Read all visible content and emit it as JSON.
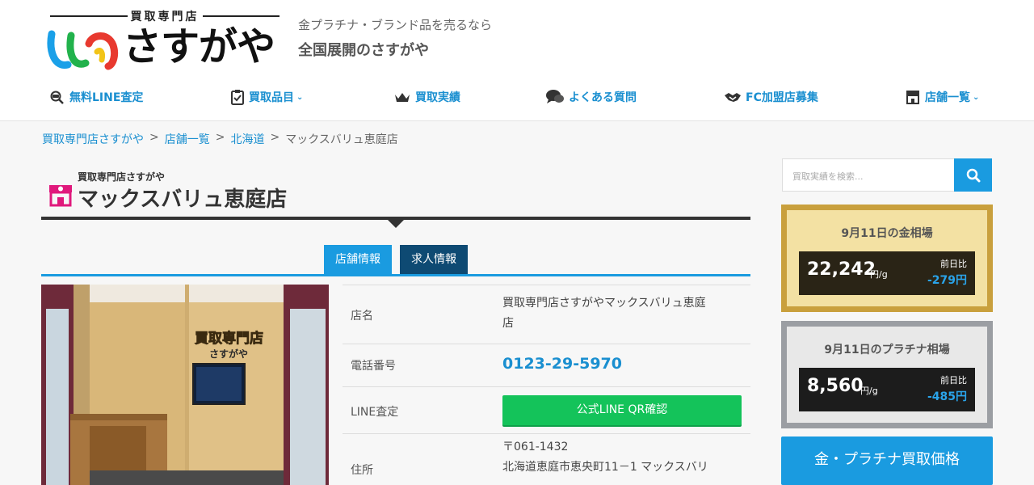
{
  "header": {
    "logo_top": "買取専門店",
    "logo_name": "さすがや",
    "tagline": "金プラチナ・ブランド品を売るなら",
    "tagline2": "全国展開のさすがや"
  },
  "nav": {
    "items": [
      {
        "label": "無料LINE査定",
        "icon": "line-magnifier-icon"
      },
      {
        "label": "買取品目",
        "icon": "clipboard-check-icon",
        "dropdown": true
      },
      {
        "label": "買取実績",
        "icon": "crown-icon"
      },
      {
        "label": "よくある質問",
        "icon": "chat-bubbles-icon"
      },
      {
        "label": "FC加盟店募集",
        "icon": "handshake-icon"
      },
      {
        "label": "店舗一覧",
        "icon": "shop-icon",
        "dropdown": true
      }
    ]
  },
  "breadcrumb": {
    "items": [
      "買取専門店さすがや",
      "店舗一覧",
      "北海道"
    ],
    "separator": ">",
    "current": "マックスバリュ恵庭店"
  },
  "title": {
    "sub": "買取専門店さすがや",
    "main": "マックスバリュ恵庭店"
  },
  "tabs": [
    {
      "label": "店舗情報",
      "active": true
    },
    {
      "label": "求人情報",
      "active": false
    }
  ],
  "photo": {
    "sign_text": "買取専門店",
    "sign_brand": "さすがや"
  },
  "info": {
    "name_label": "店名",
    "name_value_1": "買取専門店さすがやマックスバリュ恵庭",
    "name_value_2": "店",
    "phone_label": "電話番号",
    "phone_value": "0123-29-5970",
    "line_label": "LINE査定",
    "line_button": "公式LINE QR確認",
    "address_label": "住所",
    "address_postal": "〒061-1432",
    "address_line": "北海道恵庭市恵央町11－1 マックスバリ"
  },
  "sidebar": {
    "search_placeholder": "買取実績を検索...",
    "gold": {
      "title": "9月11日の金相場",
      "price": "22,242",
      "unit": "円/g",
      "compare_label": "前日比",
      "compare_value": "-279円"
    },
    "platinum": {
      "title": "9月11日のプラチナ相場",
      "price": "8,560",
      "unit": "円/g",
      "compare_label": "前日比",
      "compare_value": "-485円"
    },
    "buy_button": "金・プラチナ買取価格"
  },
  "colors": {
    "accent_blue": "#1a9be0",
    "tab_dark": "#0e4a73",
    "line_green": "#14c35a",
    "gold_border": "#c9a03d",
    "platinum_border": "#9b9ea3"
  }
}
